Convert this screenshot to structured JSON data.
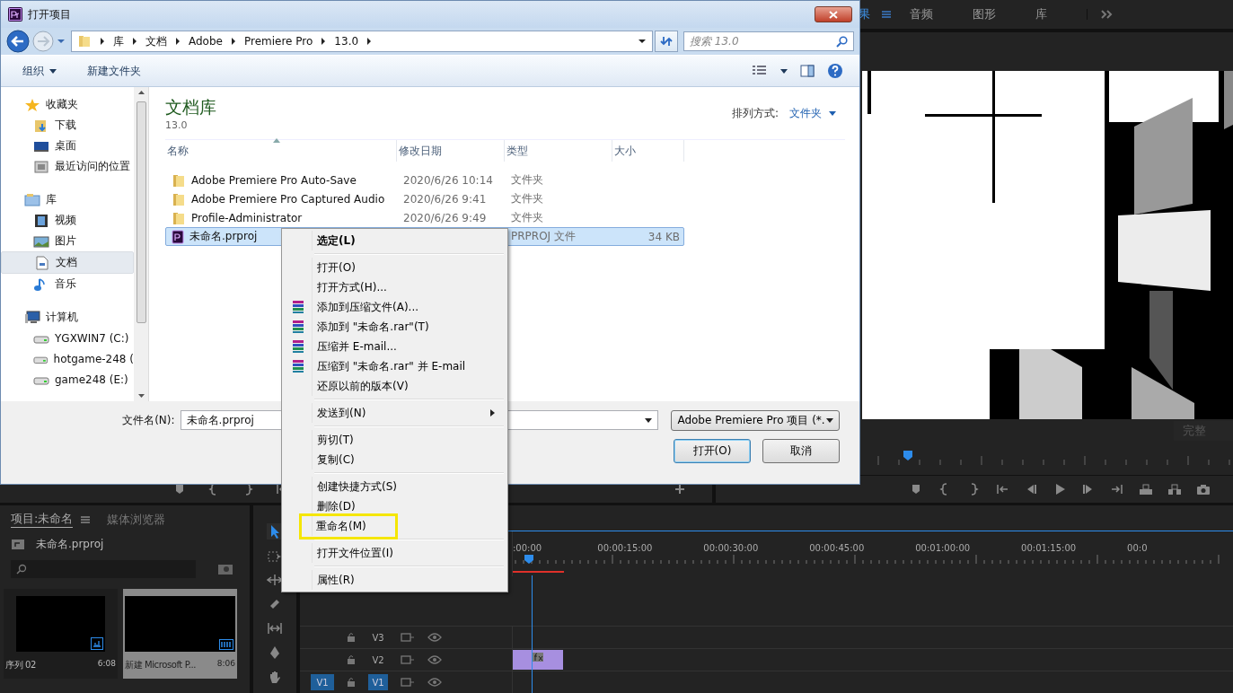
{
  "premiere": {
    "panel_tabs": [
      {
        "label": "果",
        "selected": true
      },
      {
        "label": "音频",
        "selected": false
      },
      {
        "label": "图形",
        "selected": false
      },
      {
        "label": "库",
        "selected": false
      }
    ],
    "program_monitor": {
      "fit": "完整"
    },
    "project_panel": {
      "tabs": [
        {
          "label": "项目:未命名",
          "selected": true
        },
        {
          "label": "媒体浏览器",
          "selected": false
        }
      ],
      "file": "未命名.prproj",
      "items": [
        {
          "kind": "sequence",
          "name": "序列 02",
          "duration": "6:08",
          "selected": false
        },
        {
          "kind": "clip",
          "name": "新建 Microsoft P...",
          "duration": "8:06",
          "selected": true
        }
      ]
    },
    "timeline": {
      "ruler": [
        ":00:00",
        "00:00:15:00",
        "00:00:30:00",
        "00:00:45:00",
        "00:01:00:00",
        "00:01:15:00",
        "00:0"
      ],
      "tracks": [
        {
          "name": "V3",
          "targeted": false,
          "has_clip": false
        },
        {
          "name": "V2",
          "targeted": false,
          "has_clip": true
        },
        {
          "name": "V1",
          "source": "V1",
          "targeted": true,
          "has_clip": false
        }
      ]
    }
  },
  "dialog": {
    "title": "打开项目",
    "breadcrumb": [
      "库",
      "文档",
      "Adobe",
      "Premiere Pro",
      "13.0"
    ],
    "search": {
      "placeholder": "搜索 13.0"
    },
    "toolbar": [
      {
        "label": "组织",
        "dropdown": true
      },
      {
        "label": "新建文件夹",
        "dropdown": false
      }
    ],
    "sidebar": [
      {
        "label": "收藏夹",
        "kind": "star",
        "selected": false,
        "children": [
          {
            "label": "下载",
            "kind": "download",
            "selected": false
          },
          {
            "label": "桌面",
            "kind": "desktop",
            "selected": false
          },
          {
            "label": "最近访问的位置",
            "kind": "recent",
            "selected": false
          }
        ]
      },
      {
        "label": "库",
        "kind": "library",
        "selected": false,
        "children": [
          {
            "label": "视频",
            "kind": "video",
            "selected": false
          },
          {
            "label": "图片",
            "kind": "picture",
            "selected": false
          },
          {
            "label": "文档",
            "kind": "document",
            "selected": true
          },
          {
            "label": "音乐",
            "kind": "music",
            "selected": false
          }
        ]
      },
      {
        "label": "计算机",
        "kind": "computer",
        "selected": false,
        "children": [
          {
            "label": "YGXWIN7 (C:)",
            "kind": "drive",
            "selected": false
          },
          {
            "label": "hotgame-248 (",
            "kind": "drive",
            "selected": false
          },
          {
            "label": "game248 (E:)",
            "kind": "drive",
            "selected": false
          }
        ]
      }
    ],
    "library": {
      "title": "文档库",
      "subtitle": "13.0",
      "sort_label": "排列方式:",
      "sort_value": "文件夹"
    },
    "columns": [
      "名称",
      "修改日期",
      "类型",
      "大小"
    ],
    "files": [
      {
        "kind": "folder",
        "name": "Adobe Premiere Pro Auto-Save",
        "date": "2020/6/26 10:14",
        "type": "文件夹",
        "selected": false
      },
      {
        "kind": "folder",
        "name": "Adobe Premiere Pro Captured Audio",
        "date": "2020/6/26 9:41",
        "type": "文件夹",
        "selected": false
      },
      {
        "kind": "folder",
        "name": "Profile-Administrator",
        "date": "2020/6/26 9:49",
        "type": "文件夹",
        "selected": false
      },
      {
        "kind": "project",
        "name": "未命名.prproj",
        "type": "PRPROJ 文件",
        "size": "34 KB",
        "selected": true
      }
    ],
    "filename": {
      "label": "文件名(N):",
      "value": "未命名.prproj"
    },
    "filetype": "Adobe Premiere Pro 项目 (*.",
    "buttons": [
      {
        "label": "打开(O)",
        "default": true
      },
      {
        "label": "取消",
        "default": false
      }
    ]
  },
  "context_menu": [
    {
      "kind": "item",
      "label": "选定(L)",
      "bold": true,
      "archive_icon": false,
      "submenu": false,
      "highlighted": false
    },
    {
      "kind": "separator"
    },
    {
      "kind": "item",
      "label": "打开(O)",
      "bold": false,
      "archive_icon": false,
      "submenu": false,
      "highlighted": false
    },
    {
      "kind": "item",
      "label": "打开方式(H)...",
      "bold": false,
      "archive_icon": false,
      "submenu": false,
      "highlighted": false
    },
    {
      "kind": "item",
      "label": "添加到压缩文件(A)...",
      "bold": false,
      "archive_icon": true,
      "submenu": false,
      "highlighted": false
    },
    {
      "kind": "item",
      "label": "添加到 \"未命名.rar\"(T)",
      "bold": false,
      "archive_icon": true,
      "submenu": false,
      "highlighted": false
    },
    {
      "kind": "item",
      "label": "压缩并 E-mail...",
      "bold": false,
      "archive_icon": true,
      "submenu": false,
      "highlighted": false
    },
    {
      "kind": "item",
      "label": "压缩到 \"未命名.rar\" 并 E-mail",
      "bold": false,
      "archive_icon": true,
      "submenu": false,
      "highlighted": false
    },
    {
      "kind": "item",
      "label": "还原以前的版本(V)",
      "bold": false,
      "archive_icon": false,
      "submenu": false,
      "highlighted": false
    },
    {
      "kind": "separator"
    },
    {
      "kind": "item",
      "label": "发送到(N)",
      "bold": false,
      "archive_icon": false,
      "submenu": true,
      "highlighted": false
    },
    {
      "kind": "separator"
    },
    {
      "kind": "item",
      "label": "剪切(T)",
      "bold": false,
      "archive_icon": false,
      "submenu": false,
      "highlighted": false
    },
    {
      "kind": "item",
      "label": "复制(C)",
      "bold": false,
      "archive_icon": false,
      "submenu": false,
      "highlighted": false
    },
    {
      "kind": "separator"
    },
    {
      "kind": "item",
      "label": "创建快捷方式(S)",
      "bold": false,
      "archive_icon": false,
      "submenu": false,
      "highlighted": false
    },
    {
      "kind": "item",
      "label": "删除(D)",
      "bold": false,
      "archive_icon": false,
      "submenu": false,
      "highlighted": false
    },
    {
      "kind": "item",
      "label": "重命名(M)",
      "bold": false,
      "archive_icon": false,
      "submenu": false,
      "highlighted": true
    },
    {
      "kind": "separator"
    },
    {
      "kind": "item",
      "label": "打开文件位置(I)",
      "bold": false,
      "archive_icon": false,
      "submenu": false,
      "highlighted": false
    },
    {
      "kind": "separator"
    },
    {
      "kind": "item",
      "label": "属性(R)",
      "bold": false,
      "archive_icon": false,
      "submenu": false,
      "highlighted": false
    }
  ]
}
